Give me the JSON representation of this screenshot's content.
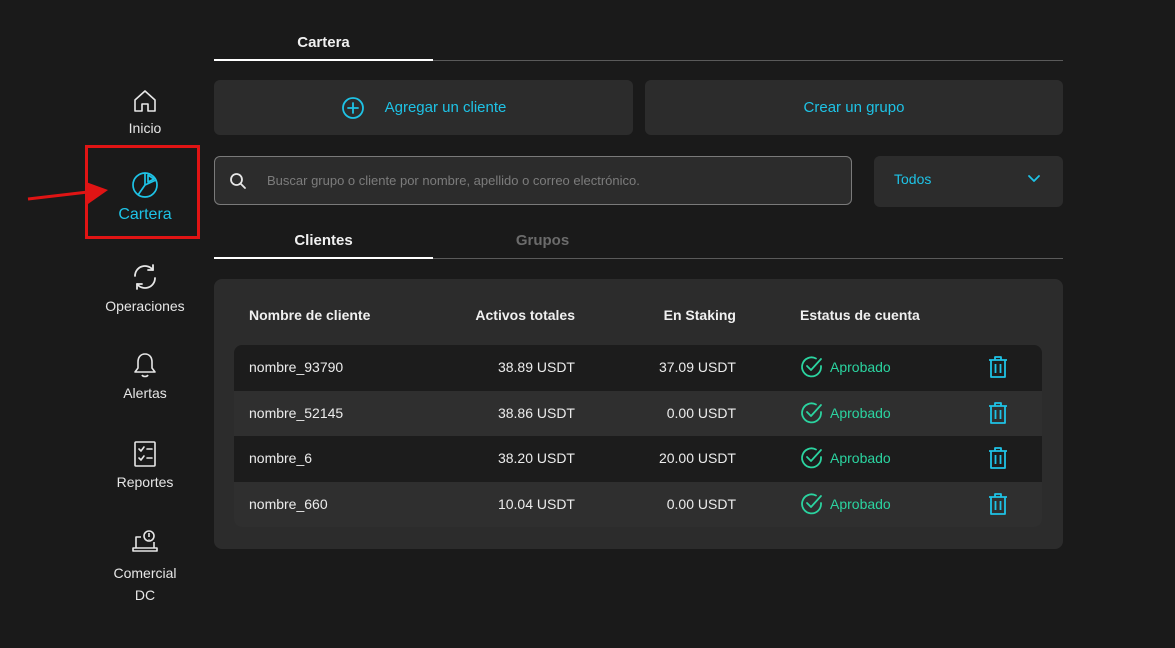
{
  "colors": {
    "accent": "#1ec3e6",
    "success": "#2bd4a0",
    "annotation": "#e01414"
  },
  "sidebar": {
    "items": [
      {
        "label": "Inicio",
        "icon": "home-icon"
      },
      {
        "label": "Cartera",
        "icon": "pie-chart-icon",
        "active": true
      },
      {
        "label": "Operaciones",
        "icon": "refresh-arrows-icon"
      },
      {
        "label": "Alertas",
        "icon": "bell-icon"
      },
      {
        "label": "Reportes",
        "icon": "checklist-icon"
      },
      {
        "label_line1": "Comercial",
        "label_line2": "DC",
        "icon": "commercial-laptop-icon"
      }
    ]
  },
  "header": {
    "tab_label": "Cartera"
  },
  "actions": {
    "add_client": "Agregar un cliente",
    "create_group": "Crear un grupo"
  },
  "search": {
    "placeholder": "Buscar grupo o cliente por nombre, apellido o correo electrónico."
  },
  "filter": {
    "selected": "Todos"
  },
  "subtabs": {
    "clients": "Clientes",
    "groups": "Grupos"
  },
  "table": {
    "headers": [
      "Nombre de cliente",
      "Activos totales",
      "En Staking",
      "Estatus de cuenta"
    ],
    "rows": [
      {
        "name": "nombre_93790",
        "total": "38.89 USDT",
        "staking": "37.09 USDT",
        "status": "Aprobado"
      },
      {
        "name": "nombre_52145",
        "total": "38.86 USDT",
        "staking": "0.00 USDT",
        "status": "Aprobado"
      },
      {
        "name": "nombre_6",
        "total": "38.20 USDT",
        "staking": "20.00 USDT",
        "status": "Aprobado"
      },
      {
        "name": "nombre_660",
        "total": "10.04 USDT",
        "staking": "0.00 USDT",
        "status": "Aprobado"
      }
    ]
  }
}
